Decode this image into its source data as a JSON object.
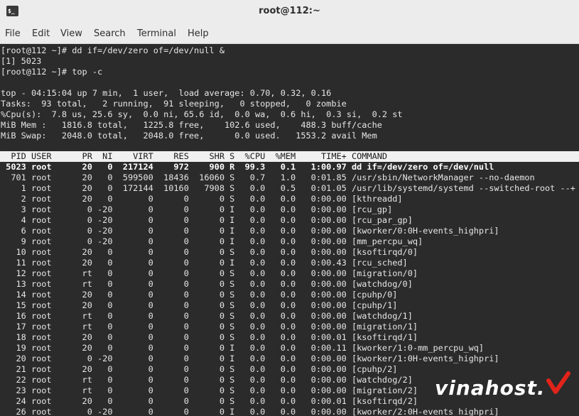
{
  "window": {
    "title": "root@112:~",
    "icon": "terminal-icon"
  },
  "menu": [
    "File",
    "Edit",
    "View",
    "Search",
    "Terminal",
    "Help"
  ],
  "shell": [
    "[root@112 ~]# dd if=/dev/zero of=/dev/null &",
    "[1] 5023",
    "[root@112 ~]# top -c"
  ],
  "summary": [
    "top - 04:15:04 up 7 min,  1 user,  load average: 0.70, 0.32, 0.16",
    "Tasks:  93 total,   2 running,  91 sleeping,   0 stopped,   0 zombie",
    "%Cpu(s):  7.8 us, 25.6 sy,  0.0 ni, 65.6 id,  0.0 wa,  0.6 hi,  0.3 si,  0.2 st",
    "MiB Mem :   1816.8 total,   1225.8 free,    102.6 used,    488.3 buff/cache",
    "MiB Swap:   2048.0 total,   2048.0 free,      0.0 used.   1553.2 avail Mem"
  ],
  "header": "  PID USER      PR  NI    VIRT    RES    SHR S  %CPU  %MEM     TIME+ COMMAND",
  "processes": [
    {
      "pid": "5023",
      "user": "root",
      "pr": "20",
      "ni": "0",
      "virt": "217124",
      "res": "972",
      "shr": "900",
      "s": "R",
      "cpu": "99.3",
      "mem": "0.1",
      "time": "1:00.97",
      "cmd": "dd if=/dev/zero of=/dev/null",
      "bold": true
    },
    {
      "pid": "701",
      "user": "root",
      "pr": "20",
      "ni": "0",
      "virt": "599500",
      "res": "18436",
      "shr": "16060",
      "s": "S",
      "cpu": "0.7",
      "mem": "1.0",
      "time": "0:01.85",
      "cmd": "/usr/sbin/NetworkManager --no-daemon"
    },
    {
      "pid": "1",
      "user": "root",
      "pr": "20",
      "ni": "0",
      "virt": "172144",
      "res": "10160",
      "shr": "7908",
      "s": "S",
      "cpu": "0.0",
      "mem": "0.5",
      "time": "0:01.05",
      "cmd": "/usr/lib/systemd/systemd --switched-root --+"
    },
    {
      "pid": "2",
      "user": "root",
      "pr": "20",
      "ni": "0",
      "virt": "0",
      "res": "0",
      "shr": "0",
      "s": "S",
      "cpu": "0.0",
      "mem": "0.0",
      "time": "0:00.00",
      "cmd": "[kthreadd]"
    },
    {
      "pid": "3",
      "user": "root",
      "pr": "0",
      "ni": "-20",
      "virt": "0",
      "res": "0",
      "shr": "0",
      "s": "I",
      "cpu": "0.0",
      "mem": "0.0",
      "time": "0:00.00",
      "cmd": "[rcu_gp]"
    },
    {
      "pid": "4",
      "user": "root",
      "pr": "0",
      "ni": "-20",
      "virt": "0",
      "res": "0",
      "shr": "0",
      "s": "I",
      "cpu": "0.0",
      "mem": "0.0",
      "time": "0:00.00",
      "cmd": "[rcu_par_gp]"
    },
    {
      "pid": "6",
      "user": "root",
      "pr": "0",
      "ni": "-20",
      "virt": "0",
      "res": "0",
      "shr": "0",
      "s": "I",
      "cpu": "0.0",
      "mem": "0.0",
      "time": "0:00.00",
      "cmd": "[kworker/0:0H-events_highpri]"
    },
    {
      "pid": "9",
      "user": "root",
      "pr": "0",
      "ni": "-20",
      "virt": "0",
      "res": "0",
      "shr": "0",
      "s": "I",
      "cpu": "0.0",
      "mem": "0.0",
      "time": "0:00.00",
      "cmd": "[mm_percpu_wq]"
    },
    {
      "pid": "10",
      "user": "root",
      "pr": "20",
      "ni": "0",
      "virt": "0",
      "res": "0",
      "shr": "0",
      "s": "S",
      "cpu": "0.0",
      "mem": "0.0",
      "time": "0:00.00",
      "cmd": "[ksoftirqd/0]"
    },
    {
      "pid": "11",
      "user": "root",
      "pr": "20",
      "ni": "0",
      "virt": "0",
      "res": "0",
      "shr": "0",
      "s": "I",
      "cpu": "0.0",
      "mem": "0.0",
      "time": "0:00.43",
      "cmd": "[rcu_sched]"
    },
    {
      "pid": "12",
      "user": "root",
      "pr": "rt",
      "ni": "0",
      "virt": "0",
      "res": "0",
      "shr": "0",
      "s": "S",
      "cpu": "0.0",
      "mem": "0.0",
      "time": "0:00.00",
      "cmd": "[migration/0]"
    },
    {
      "pid": "13",
      "user": "root",
      "pr": "rt",
      "ni": "0",
      "virt": "0",
      "res": "0",
      "shr": "0",
      "s": "S",
      "cpu": "0.0",
      "mem": "0.0",
      "time": "0:00.00",
      "cmd": "[watchdog/0]"
    },
    {
      "pid": "14",
      "user": "root",
      "pr": "20",
      "ni": "0",
      "virt": "0",
      "res": "0",
      "shr": "0",
      "s": "S",
      "cpu": "0.0",
      "mem": "0.0",
      "time": "0:00.00",
      "cmd": "[cpuhp/0]"
    },
    {
      "pid": "15",
      "user": "root",
      "pr": "20",
      "ni": "0",
      "virt": "0",
      "res": "0",
      "shr": "0",
      "s": "S",
      "cpu": "0.0",
      "mem": "0.0",
      "time": "0:00.00",
      "cmd": "[cpuhp/1]"
    },
    {
      "pid": "16",
      "user": "root",
      "pr": "rt",
      "ni": "0",
      "virt": "0",
      "res": "0",
      "shr": "0",
      "s": "S",
      "cpu": "0.0",
      "mem": "0.0",
      "time": "0:00.00",
      "cmd": "[watchdog/1]"
    },
    {
      "pid": "17",
      "user": "root",
      "pr": "rt",
      "ni": "0",
      "virt": "0",
      "res": "0",
      "shr": "0",
      "s": "S",
      "cpu": "0.0",
      "mem": "0.0",
      "time": "0:00.00",
      "cmd": "[migration/1]"
    },
    {
      "pid": "18",
      "user": "root",
      "pr": "20",
      "ni": "0",
      "virt": "0",
      "res": "0",
      "shr": "0",
      "s": "S",
      "cpu": "0.0",
      "mem": "0.0",
      "time": "0:00.01",
      "cmd": "[ksoftirqd/1]"
    },
    {
      "pid": "19",
      "user": "root",
      "pr": "20",
      "ni": "0",
      "virt": "0",
      "res": "0",
      "shr": "0",
      "s": "I",
      "cpu": "0.0",
      "mem": "0.0",
      "time": "0:00.11",
      "cmd": "[kworker/1:0-mm_percpu_wq]"
    },
    {
      "pid": "20",
      "user": "root",
      "pr": "0",
      "ni": "-20",
      "virt": "0",
      "res": "0",
      "shr": "0",
      "s": "I",
      "cpu": "0.0",
      "mem": "0.0",
      "time": "0:00.00",
      "cmd": "[kworker/1:0H-events_highpri]"
    },
    {
      "pid": "21",
      "user": "root",
      "pr": "20",
      "ni": "0",
      "virt": "0",
      "res": "0",
      "shr": "0",
      "s": "S",
      "cpu": "0.0",
      "mem": "0.0",
      "time": "0:00.00",
      "cmd": "[cpuhp/2]"
    },
    {
      "pid": "22",
      "user": "root",
      "pr": "rt",
      "ni": "0",
      "virt": "0",
      "res": "0",
      "shr": "0",
      "s": "S",
      "cpu": "0.0",
      "mem": "0.0",
      "time": "0:00.00",
      "cmd": "[watchdog/2]"
    },
    {
      "pid": "23",
      "user": "root",
      "pr": "rt",
      "ni": "0",
      "virt": "0",
      "res": "0",
      "shr": "0",
      "s": "S",
      "cpu": "0.0",
      "mem": "0.0",
      "time": "0:00.00",
      "cmd": "[migration/2]"
    },
    {
      "pid": "24",
      "user": "root",
      "pr": "20",
      "ni": "0",
      "virt": "0",
      "res": "0",
      "shr": "0",
      "s": "S",
      "cpu": "0.0",
      "mem": "0.0",
      "time": "0:00.01",
      "cmd": "[ksoftirqd/2]"
    },
    {
      "pid": "26",
      "user": "root",
      "pr": "0",
      "ni": "-20",
      "virt": "0",
      "res": "0",
      "shr": "0",
      "s": "I",
      "cpu": "0.0",
      "mem": "0.0",
      "time": "0:00.00",
      "cmd": "[kworker/2:0H-events_highpri]"
    }
  ],
  "watermark": "vinahost.",
  "colors": {
    "terminal_bg": "#2b2b2b",
    "terminal_fg": "#e6e6e6",
    "header_bg": "#f0f0f0",
    "chrome_bg": "#ececec",
    "watermark_accent": "#e2231a"
  }
}
